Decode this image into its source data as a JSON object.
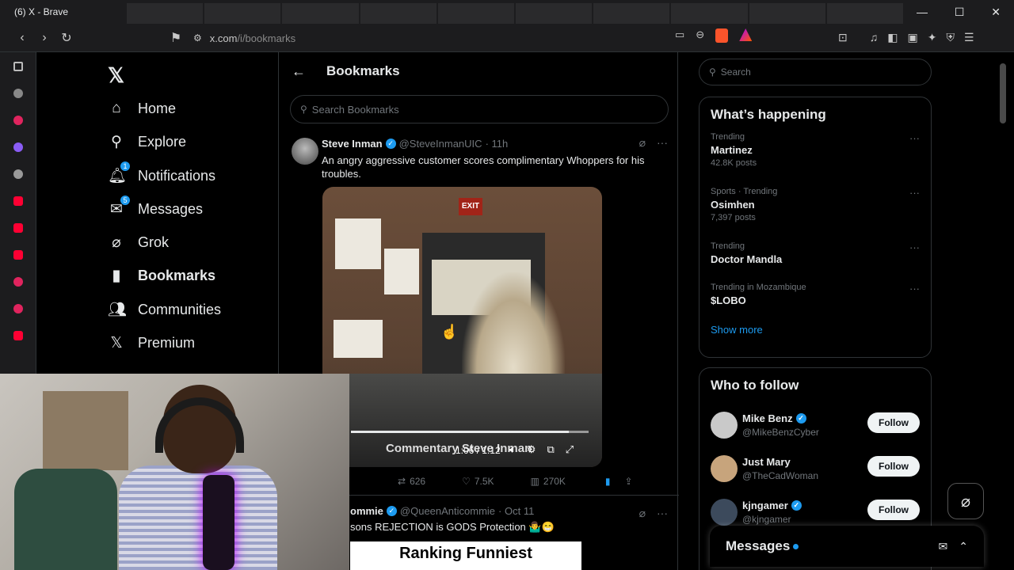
{
  "browser": {
    "tab_title": "(6) X - Brave",
    "url_prefix": "x.com",
    "url_path": "/i/bookmarks",
    "bat_badge": "1"
  },
  "nav": {
    "items": [
      {
        "label": "Home",
        "icon": "home-icon"
      },
      {
        "label": "Explore",
        "icon": "search-icon"
      },
      {
        "label": "Notifications",
        "icon": "bell-icon",
        "badge": "1"
      },
      {
        "label": "Messages",
        "icon": "envelope-icon",
        "badge": "5"
      },
      {
        "label": "Grok",
        "icon": "grok-icon"
      },
      {
        "label": "Bookmarks",
        "icon": "bookmark-icon",
        "active": true
      },
      {
        "label": "Communities",
        "icon": "people-icon"
      },
      {
        "label": "Premium",
        "icon": "x-icon"
      }
    ]
  },
  "main": {
    "title": "Bookmarks",
    "search_placeholder": "Search Bookmarks",
    "tweet1": {
      "name": "Steve Inman",
      "handle": "@SteveInmanUIC",
      "time": "· 11h",
      "text": "An angry aggressive customer scores complimentary Whoppers for his troubles.",
      "video_overlay": "Commentary Steve Inman",
      "video_time": "1:06 / 1:12",
      "video_progress": 0.917,
      "retweets": "626",
      "likes": "7.5K",
      "views": "270K"
    },
    "tweet2": {
      "name": "ommie",
      "handle": "@QueenAnticommie",
      "time": "· Oct 11",
      "text": "sons REJECTION is GODS Protection 🤷‍♂️😁",
      "media_text": "Ranking Funniest"
    }
  },
  "right": {
    "search_placeholder": "Search",
    "happening_title": "What’s happening",
    "trends": [
      {
        "context": "Trending",
        "topic": "Martinez",
        "posts": "42.8K posts"
      },
      {
        "context": "Sports · Trending",
        "topic": "Osimhen",
        "posts": "7,397 posts"
      },
      {
        "context": "Trending",
        "topic": "Doctor Mandla",
        "posts": ""
      },
      {
        "context": "Trending in Mozambique",
        "topic": "$LOBO",
        "posts": ""
      }
    ],
    "show_more": "Show more",
    "wtf_title": "Who to follow",
    "follow_suggestions": [
      {
        "name": "Mike Benz",
        "handle": "@MikeBenzCyber",
        "button": "Follow"
      },
      {
        "name": "Just Mary",
        "handle": "@TheCadWoman",
        "button": "Follow"
      },
      {
        "name": "kjngamer",
        "handle": "@kjngamer",
        "button": "Follow"
      }
    ],
    "messages_label": "Messages"
  },
  "colors": {
    "accent": "#1d9bf0",
    "background": "#000000",
    "text": "#e7e9ea",
    "muted": "#71767b"
  }
}
